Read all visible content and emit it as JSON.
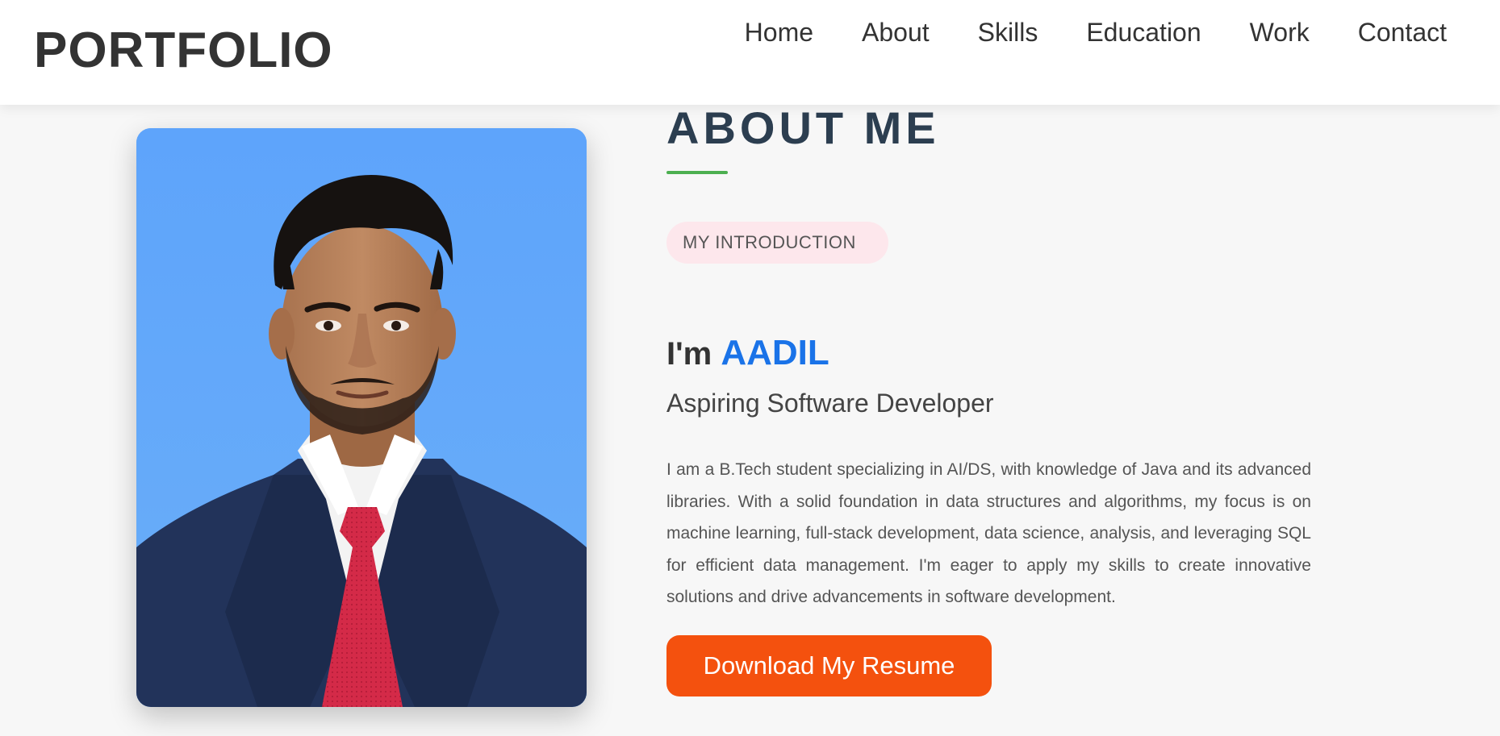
{
  "header": {
    "logo": "PORTFOLIO",
    "nav": [
      {
        "label": "Home"
      },
      {
        "label": "About"
      },
      {
        "label": "Skills"
      },
      {
        "label": "Education"
      },
      {
        "label": "Work"
      },
      {
        "label": "Contact"
      }
    ]
  },
  "about": {
    "title": "ABOUT ME",
    "badge": "MY INTRODUCTION",
    "greeting_prefix": "I'm ",
    "name": "AADIL",
    "role": "Aspiring Software Developer",
    "bio": "I am a B.Tech student specializing in AI/DS, with knowledge of Java and its advanced libraries. With a solid foundation in data structures and algorithms, my focus is on machine learning, full-stack development, data science, analysis, and leveraging SQL for efficient data management. I'm eager to apply my skills to create innovative solutions and drive advancements in software development.",
    "resume_button": "Download My Resume"
  },
  "colors": {
    "accent_blue": "#1a73e8",
    "button_orange": "#f4510e",
    "underline_green": "#4caf50",
    "badge_pink": "#fde7ec",
    "title_navy": "#2c3e50"
  },
  "icons": {
    "photo": "profile-photo"
  }
}
